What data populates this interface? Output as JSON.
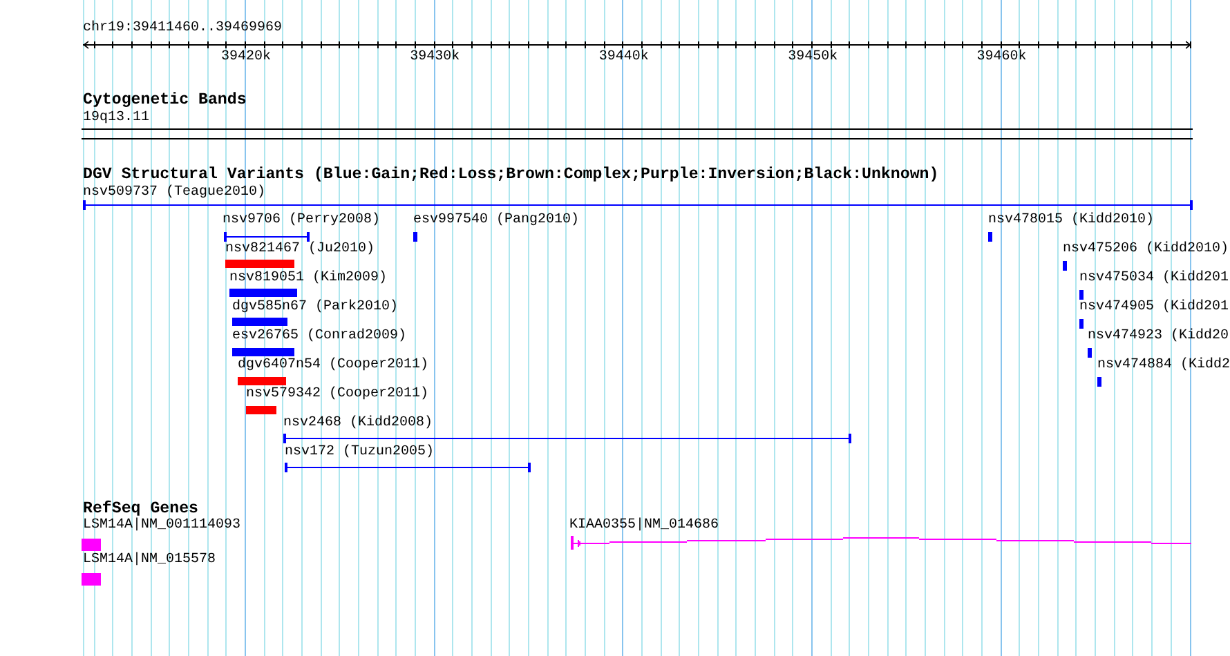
{
  "ruler": {
    "region": "chr19:39411460..39469969",
    "ticks": [
      "39420k",
      "39430k",
      "39440k",
      "39450k",
      "39460k"
    ]
  },
  "cytogenetic_bands": {
    "title": "Cytogenetic Bands",
    "band": "19q13.11"
  },
  "dgv_variants": {
    "title": "DGV Structural Variants (Blue:Gain;Red:Loss;Brown:Complex;Purple:Inversion;Black:Unknown)",
    "features": [
      {
        "label": "nsv509737 (Teague2010)",
        "kind": "span",
        "color": "#0000ff"
      },
      {
        "label": "nsv9706 (Perry2008)",
        "kind": "span",
        "color": "#0000ff"
      },
      {
        "label": "esv997540 (Pang2010)",
        "kind": "span",
        "color": "#0000ff"
      },
      {
        "label": "nsv478015 (Kidd2010)",
        "kind": "span",
        "color": "#0000ff"
      },
      {
        "label": "nsv821467 (Ju2010)",
        "kind": "bar",
        "color": "#ff0000"
      },
      {
        "label": "nsv475206 (Kidd2010)",
        "kind": "span",
        "color": "#0000ff"
      },
      {
        "label": "nsv819051 (Kim2009)",
        "kind": "bar",
        "color": "#0000ff"
      },
      {
        "label": "nsv475034 (Kidd201",
        "kind": "span",
        "color": "#0000ff"
      },
      {
        "label": "dgv585n67 (Park2010)",
        "kind": "bar",
        "color": "#0000ff"
      },
      {
        "label": "nsv474905 (Kidd201",
        "kind": "span",
        "color": "#0000ff"
      },
      {
        "label": "esv26765 (Conrad2009)",
        "kind": "bar",
        "color": "#0000ff"
      },
      {
        "label": "nsv474923 (Kidd20",
        "kind": "span",
        "color": "#0000ff"
      },
      {
        "label": "dgv6407n54 (Cooper2011)",
        "kind": "bar",
        "color": "#ff0000"
      },
      {
        "label": "nsv474884 (Kidd2",
        "kind": "span",
        "color": "#0000ff"
      },
      {
        "label": "nsv579342 (Cooper2011)",
        "kind": "bar",
        "color": "#ff0000"
      },
      {
        "label": "nsv2468 (Kidd2008)",
        "kind": "span",
        "color": "#0000ff"
      },
      {
        "label": "nsv172 (Tuzun2005)",
        "kind": "span",
        "color": "#0000ff"
      }
    ]
  },
  "refseq_genes": {
    "title": "RefSeq Genes",
    "features": [
      {
        "label": "LSM14A|NM_001114093",
        "kind": "block"
      },
      {
        "label": "LSM14A|NM_015578",
        "kind": "block"
      },
      {
        "label": "KIAA0355|NM_014686",
        "kind": "transcript"
      }
    ]
  }
}
